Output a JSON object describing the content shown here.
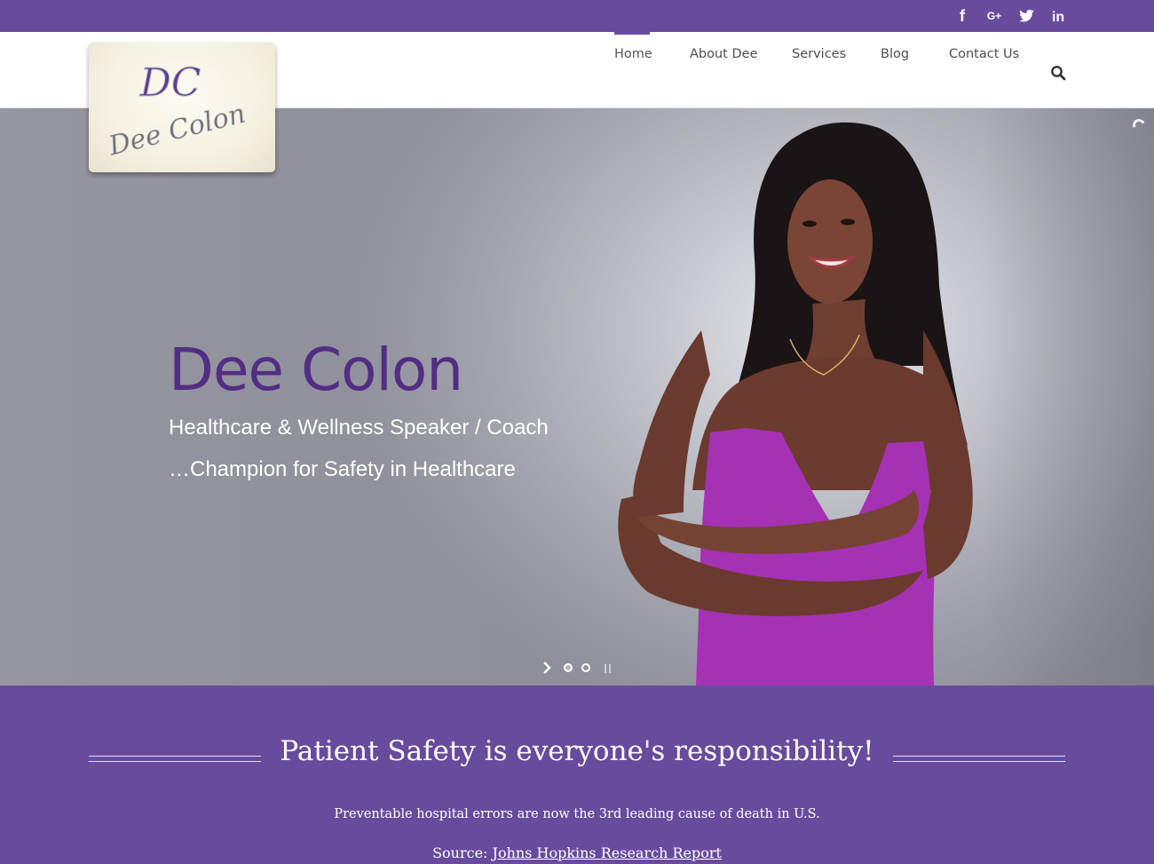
{
  "social": {
    "icons": [
      "facebook-icon",
      "google-plus-icon",
      "twitter-icon",
      "linkedin-icon"
    ],
    "facebook_glyph": "f",
    "google_glyph": "G+",
    "linkedin_glyph": "in"
  },
  "logo": {
    "monogram": "DC",
    "name": "Dee Colon"
  },
  "nav": {
    "items": [
      {
        "label": "Home",
        "active": true
      },
      {
        "label": "About Dee",
        "active": false
      },
      {
        "label": "Services",
        "active": false
      },
      {
        "label": "Blog",
        "active": false
      },
      {
        "label": "Contact Us",
        "active": false
      }
    ],
    "search_icon": "search-icon"
  },
  "hero": {
    "title": "Dee Colon",
    "subtitle_1": "Healthcare & Wellness Speaker / Coach",
    "subtitle_2": "…Champion for Safety in Healthcare",
    "slider": {
      "slides": 2,
      "current": 1
    }
  },
  "mission": {
    "title": "Patient Safety is everyone's responsibility!",
    "text": "Preventable hospital errors are now the 3rd leading cause of death in U.S.",
    "source_label": "Source:",
    "source_link": "Johns Hopkins Research Report"
  },
  "colors": {
    "brand_purple": "#684b9d",
    "title_purple": "#532d84",
    "dress_magenta": "#a531b4"
  }
}
